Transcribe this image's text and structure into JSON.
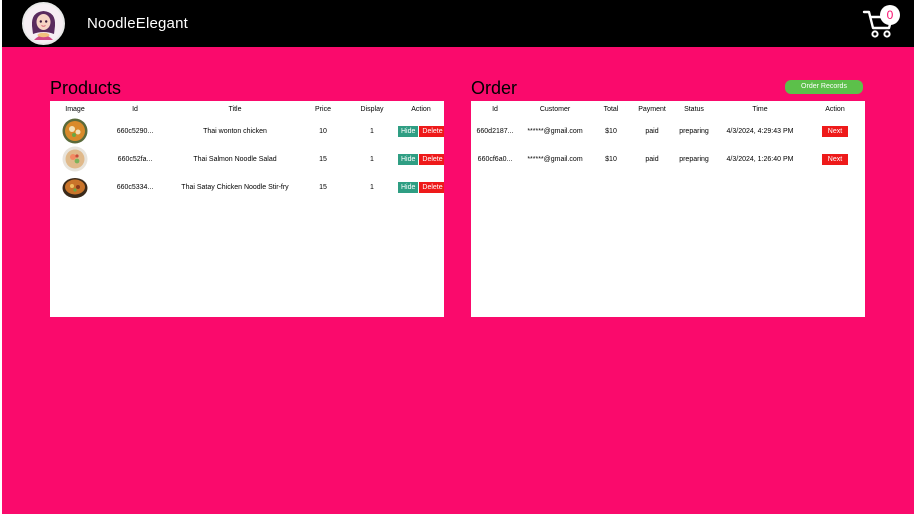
{
  "header": {
    "brand": "NoodleElegant",
    "cart_count": "0"
  },
  "products": {
    "title": "Products",
    "columns": [
      "Image",
      "Id",
      "Title",
      "Price",
      "Display",
      "Action"
    ],
    "rows": [
      {
        "id": "660c5290...",
        "title": "Thai wonton chicken",
        "price": "10",
        "display": "1",
        "image": "soup-bowl"
      },
      {
        "id": "660c52fa...",
        "title": "Thai Salmon Noodle Salad",
        "price": "15",
        "display": "1",
        "image": "salad-plate"
      },
      {
        "id": "660c5334...",
        "title": "Thai Satay Chicken Noodle Stir-fry",
        "price": "15",
        "display": "1",
        "image": "stir-fry-bowl"
      }
    ],
    "hide_label": "Hide",
    "delete_label": "Delete"
  },
  "order": {
    "title": "Order",
    "records_label": "Order Records",
    "columns": [
      "Id",
      "Customer",
      "Total",
      "Payment",
      "Status",
      "Time",
      "Action"
    ],
    "rows": [
      {
        "id": "660d2187...",
        "customer": "******@gmail.com",
        "total": "$10",
        "payment": "paid",
        "status": "preparing",
        "time": "4/3/2024, 4:29:43 PM"
      },
      {
        "id": "660cf6a0...",
        "customer": "******@gmail.com",
        "total": "$10",
        "payment": "paid",
        "status": "preparing",
        "time": "4/3/2024, 1:26:40 PM"
      }
    ],
    "next_label": "Next"
  },
  "colors": {
    "background": "#fa0a6c",
    "header": "#000000",
    "hide_button": "#2f9e83",
    "delete_button": "#ee1a1a",
    "records_button": "#5cc04a"
  }
}
